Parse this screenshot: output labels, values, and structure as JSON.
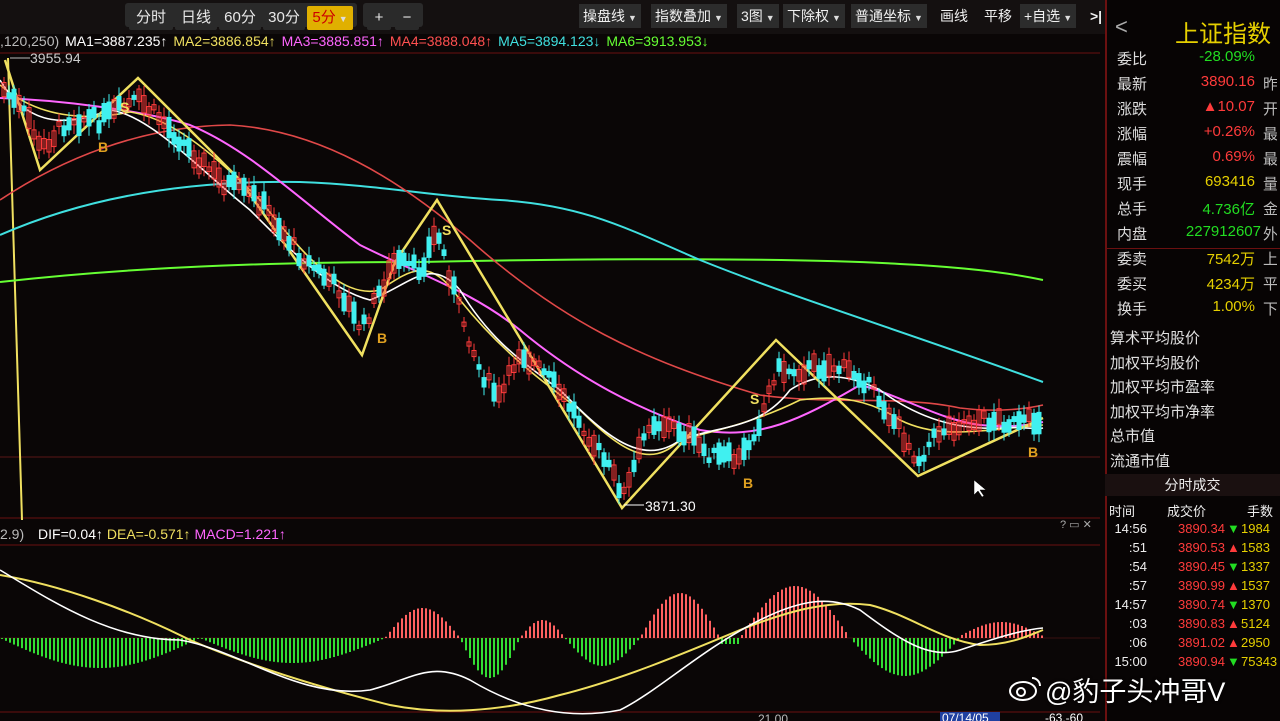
{
  "toolbar": {
    "periods": [
      "分时",
      "日线",
      "60分",
      "30分",
      "5分"
    ],
    "active_period": "5分",
    "plus_label": "+",
    "minus_label": "−",
    "right_buttons": [
      "操盘线",
      "指数叠加",
      "3图",
      "下除权",
      "普通坐标",
      "画线",
      "平移",
      "+自选"
    ],
    "collapse_icon": ">|"
  },
  "ma_line": {
    "prefix": ",120,250)",
    "ma1": "MA1=3887.235↑",
    "ma2": "MA2=3886.854↑",
    "ma3": "MA3=3885.851↑",
    "ma4": "MA4=3888.048↑",
    "ma5": "MA5=3894.123↓",
    "ma6": "MA6=3913.953↓"
  },
  "chart_labels": {
    "high": "3955.94",
    "low": "3871.30",
    "signals": [
      "B",
      "S",
      "B",
      "S",
      "B",
      "S",
      "B"
    ]
  },
  "macd_line": {
    "prefix": "2.9)",
    "dif": "DIF=0.04↑",
    "dea": "DEA=-0.571↑",
    "macd": "MACD=1.221↑"
  },
  "bottom_axis": {
    "date": "07/14/05",
    "right": "-63,-60",
    "partial": "21.00"
  },
  "panel": {
    "title": "上证指数",
    "back_icon": "<",
    "quote_rows": [
      {
        "label": "委比",
        "value": "-28.09%",
        "color": "#22dd22",
        "suffix": ""
      },
      {
        "label": "最新",
        "value": "3890.16",
        "color": "#ff3b3b",
        "suffix": "昨"
      },
      {
        "label": "涨跌",
        "value": "▲10.07",
        "color": "#ff3b3b",
        "suffix": "开"
      },
      {
        "label": "涨幅",
        "value": "+0.26%",
        "color": "#ff3b3b",
        "suffix": "最"
      },
      {
        "label": "震幅",
        "value": "0.69%",
        "color": "#ff3b3b",
        "suffix": "最"
      },
      {
        "label": "现手",
        "value": "693416",
        "color": "#e6d000",
        "suffix": "量"
      },
      {
        "label": "总手",
        "value": "4.736亿",
        "color": "#22dd22",
        "suffix": "金"
      },
      {
        "label": "内盘",
        "value": "227912607",
        "color": "#22dd22",
        "suffix": "外"
      },
      {
        "label": "委卖",
        "value": "7542万",
        "color": "#e6d000",
        "suffix": "上"
      },
      {
        "label": "委买",
        "value": "4234万",
        "color": "#e6d000",
        "suffix": "平"
      },
      {
        "label": "换手",
        "value": "1.00%",
        "color": "#e6d000",
        "suffix": "下"
      }
    ],
    "index_rows": [
      "算术平均股价",
      "加权平均股价",
      "加权平均市盈率",
      "加权平均市净率",
      "总市值",
      "流通市值"
    ],
    "ticks_title": "分时成交",
    "ticks_cols": [
      "时间",
      "成交价",
      "手数"
    ],
    "ticks": [
      {
        "time": "14:56",
        "price": "3890.34",
        "dir": "▼",
        "dir_color": "#22dd22",
        "vol": "1984"
      },
      {
        "time": ":51",
        "price": "3890.53",
        "dir": "▲",
        "dir_color": "#ff3b3b",
        "vol": "1583"
      },
      {
        "time": ":54",
        "price": "3890.45",
        "dir": "▼",
        "dir_color": "#22dd22",
        "vol": "1337"
      },
      {
        "time": ":57",
        "price": "3890.99",
        "dir": "▲",
        "dir_color": "#ff3b3b",
        "vol": "1537"
      },
      {
        "time": "14:57",
        "price": "3890.74",
        "dir": "▼",
        "dir_color": "#22dd22",
        "vol": "1370"
      },
      {
        "time": ":03",
        "price": "3890.83",
        "dir": "▲",
        "dir_color": "#ff3b3b",
        "vol": "5124"
      },
      {
        "time": ":06",
        "price": "3891.02",
        "dir": "▲",
        "dir_color": "#ff3b3b",
        "vol": "2950"
      },
      {
        "time": "15:00",
        "price": "3890.94",
        "dir": "▼",
        "dir_color": "#22dd22",
        "vol": "75343"
      }
    ]
  },
  "watermark": "@豹子头冲哥V",
  "colors": {
    "ma1": "#ffffff",
    "ma2": "#f0e060",
    "ma3": "#ff66ff",
    "ma4": "#ff5050",
    "ma5": "#40e0e0",
    "ma6": "#66ff33",
    "up": "#ff3b3b",
    "down": "#22dd22",
    "candle_down": "#40f0f0",
    "signal": "#f0e060"
  }
}
